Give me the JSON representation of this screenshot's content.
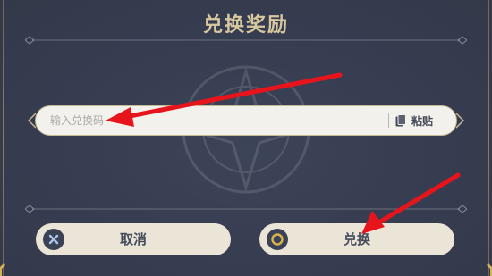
{
  "dialog": {
    "title": "兑换奖励"
  },
  "redeem_input": {
    "placeholder": "输入兑换码",
    "value": ""
  },
  "paste_button": {
    "label": "粘贴",
    "icon": "clipboard-icon"
  },
  "cancel_button": {
    "label": "取消",
    "icon": "close-icon"
  },
  "confirm_button": {
    "label": "兑换",
    "icon": "confirm-circle-icon"
  },
  "colors": {
    "background": "#383e52",
    "title": "#d8c8a0",
    "button_bg": "#ebe5d7",
    "input_bg": "#f3f1ec",
    "arrow": "#e8141c",
    "confirm_ring": "#d8b54a",
    "cancel_x": "#a9c8e8"
  }
}
